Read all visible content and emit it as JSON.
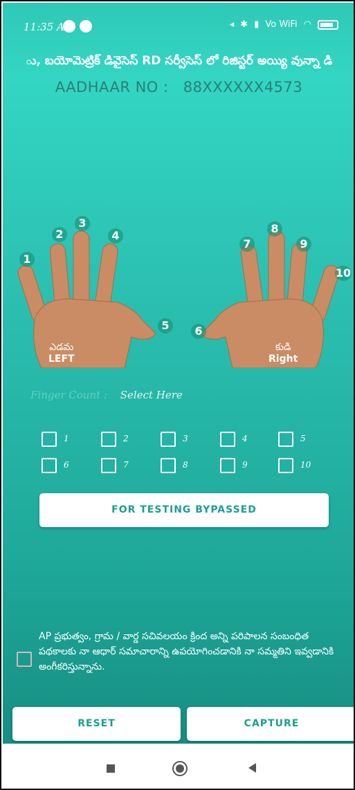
{
  "status_bar": {
    "time": "11:35 AM",
    "network": "Vo WiFi",
    "battery": "62"
  },
  "title_bar": {
    "text": "ు, బయోమెట్రిక్ డివైసెస్ RD సర్వీసెస్ లో రిజిస్టర్ అయ్యి వున్నా డి"
  },
  "aadhaar": {
    "label": "AADHAAR NO :",
    "value": "88XXXXXX4573"
  },
  "hands": {
    "left_caption_te": "ఎడమ",
    "left_caption_en": "LEFT",
    "right_caption_te": "కుడి",
    "right_caption_en": "Right",
    "finger_numbers": [
      "1",
      "2",
      "3",
      "4",
      "5",
      "6",
      "7",
      "8",
      "9",
      "10"
    ]
  },
  "finger_count": {
    "label": "Finger Count :",
    "value": "Select Here"
  },
  "checkboxes": {
    "labels": [
      "1",
      "2",
      "3",
      "4",
      "5",
      "6",
      "7",
      "8",
      "9",
      "10"
    ]
  },
  "bypass_button": "FOR TESTING BYPASSED",
  "consent": {
    "text": "AP ప్రభుత్వం, గ్రామ / వార్డ సచివలయం క్రింద అన్ని పరిపాలన సంబంధిత పథకాలకు నా ఆధార్ సమాచారాన్ని ఉపయోగించడానికి నా సమ్మతిని ఇవ్వడానికి అంగీకరిస్తున్నాను."
  },
  "buttons": {
    "reset": "RESET",
    "capture": "CAPTURE"
  },
  "colors": {
    "accent": "#1a9f90",
    "background_top": "#33d6c3",
    "background_bottom": "#168f82"
  }
}
